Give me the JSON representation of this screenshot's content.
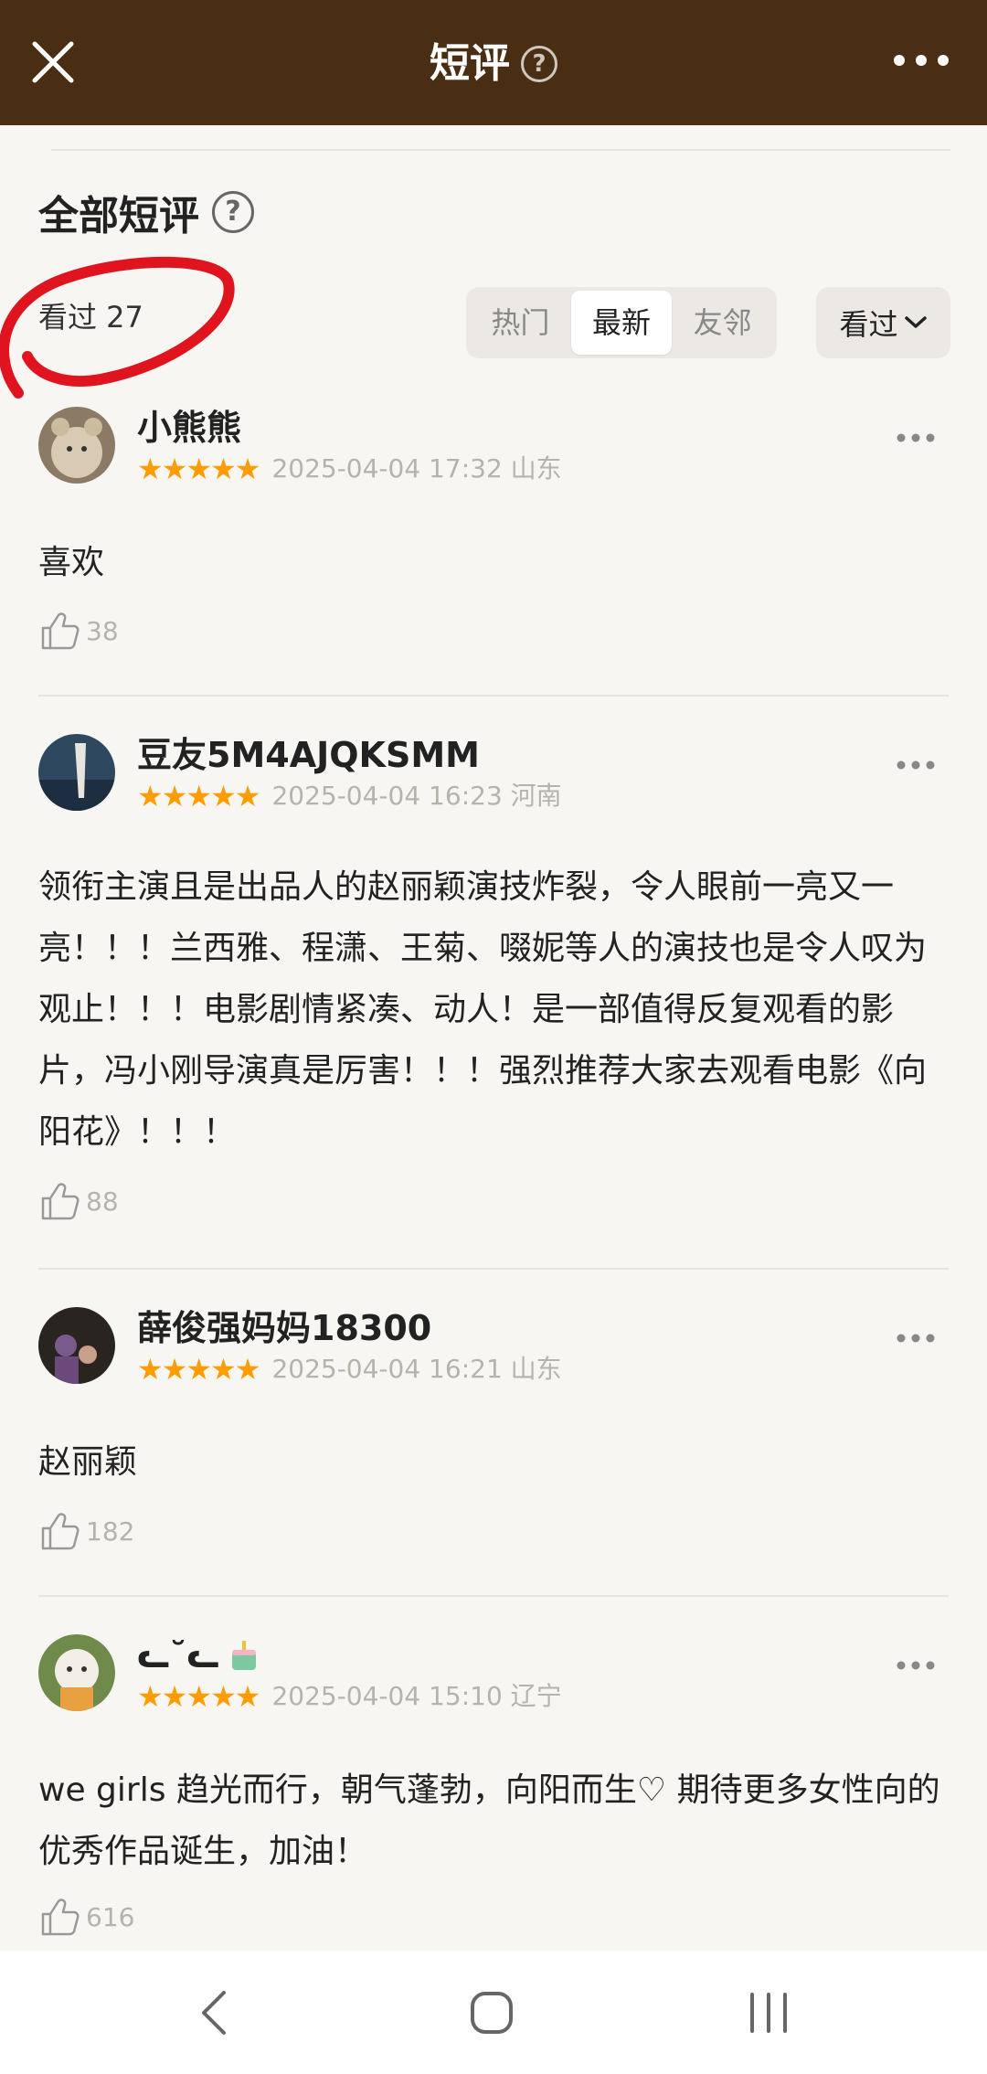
{
  "header": {
    "title": "短评"
  },
  "section": {
    "title": "全部短评",
    "seen_label": "看过 27"
  },
  "tabs": [
    "热门",
    "最新",
    "友邻"
  ],
  "filter": {
    "label": "看过"
  },
  "reviews": [
    {
      "user": "小熊熊",
      "stars": "★★★★★",
      "time": "2025-04-04 17:32 山东",
      "text": "喜欢",
      "likes": "38"
    },
    {
      "user": "豆友5M4AJQKSMM",
      "stars": "★★★★★",
      "time": "2025-04-04 16:23 河南",
      "text": "领衔主演且是出品人的赵丽颖演技炸裂，令人眼前一亮又一亮！！！兰西雅、程潇、王菊、啜妮等人的演技也是令人叹为观止！！！电影剧情紧凑、动人！是一部值得反复观看的影片，冯小刚导演真是厉害！！！强烈推荐大家去观看电影《向阳花》！！！",
      "likes": "88"
    },
    {
      "user": "薛俊强妈妈18300",
      "stars": "★★★★★",
      "time": "2025-04-04 16:21 山东",
      "text": "赵丽颖",
      "likes": "182"
    },
    {
      "user": "ᓚ˘ᓚ",
      "stars": "★★★★★",
      "time": "2025-04-04 15:10 辽宁",
      "text": "we girls 趋光而行，朝气蓬勃，向阳而生♡ 期待更多女性向的优秀作品诞生，加油！",
      "likes": "616"
    }
  ],
  "colors": {
    "header_bg": "#4a2e14",
    "star": "#ff9d00",
    "annotation": "#e0141e"
  }
}
